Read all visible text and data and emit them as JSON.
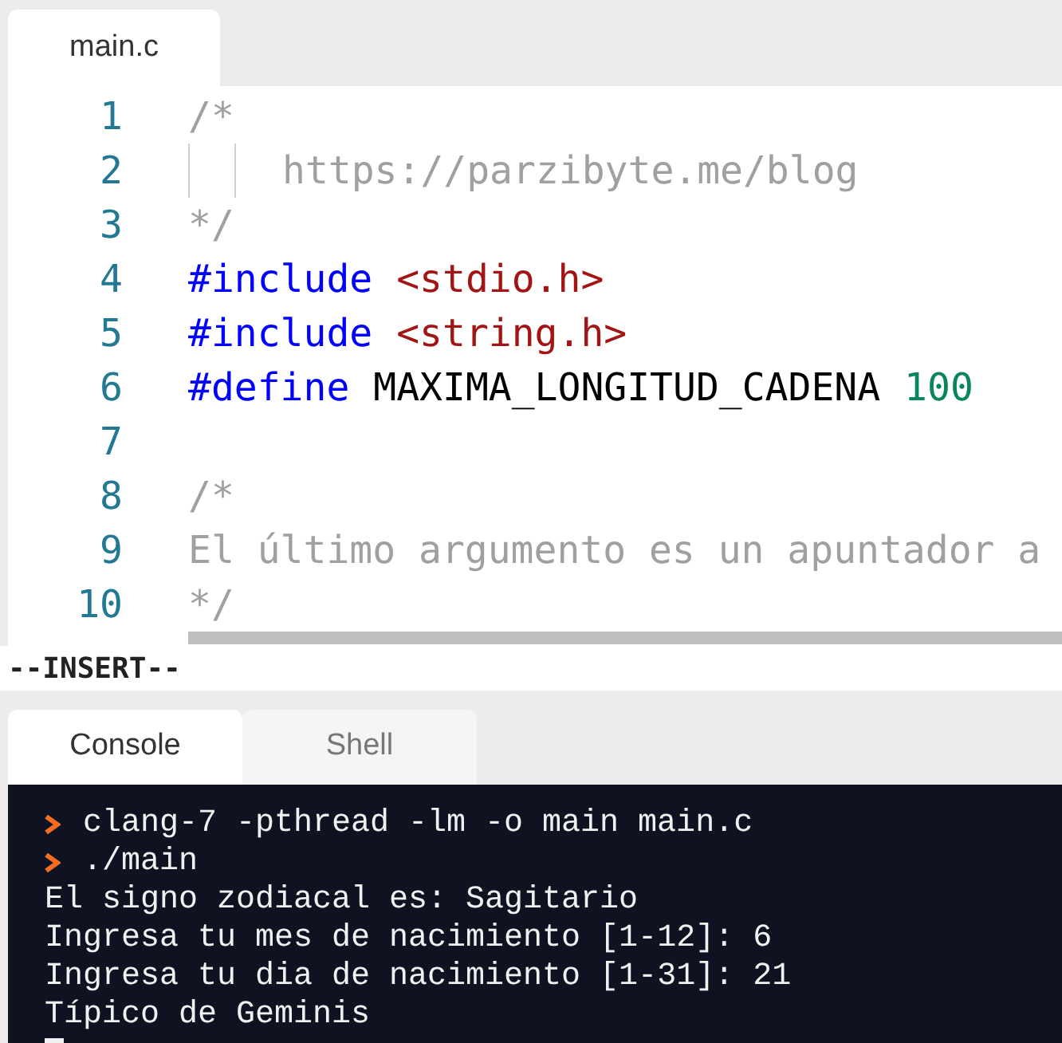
{
  "editor_tabs": [
    {
      "label": "main.c",
      "selected": true
    }
  ],
  "code_lines": [
    {
      "number": "1",
      "tokens": [
        {
          "kind": "comment",
          "text": "/*"
        }
      ]
    },
    {
      "number": "2",
      "guides": true,
      "tokens": [
        {
          "kind": "comment",
          "text": "https://parzibyte.me/blog"
        }
      ]
    },
    {
      "number": "3",
      "tokens": [
        {
          "kind": "comment",
          "text": "*/"
        }
      ]
    },
    {
      "number": "4",
      "tokens": [
        {
          "kind": "keyword",
          "text": "#include"
        },
        {
          "kind": "string",
          "text": "<stdio.h>"
        }
      ]
    },
    {
      "number": "5",
      "tokens": [
        {
          "kind": "keyword",
          "text": "#include"
        },
        {
          "kind": "string",
          "text": "<string.h>"
        }
      ]
    },
    {
      "number": "6",
      "tokens": [
        {
          "kind": "keyword",
          "text": "#define"
        },
        {
          "kind": "plain",
          "text": "MAXIMA_LONGITUD_CADENA"
        },
        {
          "kind": "number",
          "text": "100"
        }
      ]
    },
    {
      "number": "7"
    },
    {
      "number": "8",
      "tokens": [
        {
          "kind": "comment",
          "text": "/*"
        }
      ]
    },
    {
      "number": "9",
      "tokens": [
        {
          "kind": "comment",
          "text": "El último argumento es un apuntador a"
        }
      ]
    },
    {
      "number": "10",
      "tokens": [
        {
          "kind": "comment",
          "text": "*/"
        }
      ]
    }
  ],
  "mode_line": "--INSERT--",
  "console_tabs": [
    {
      "label": "Console",
      "selected": true
    },
    {
      "label": "Shell",
      "selected": false
    }
  ],
  "console_lines": [
    {
      "kind": "command",
      "text": "clang-7 -pthread -lm -o main main.c"
    },
    {
      "kind": "command",
      "text": "./main"
    },
    {
      "kind": "output",
      "text": "El signo zodiacal es: Sagitario"
    },
    {
      "kind": "output",
      "text": "Ingresa tu mes de nacimiento [1-12]: 6"
    },
    {
      "kind": "output",
      "text": "Ingresa tu dia de nacimiento [1-31]: 21"
    },
    {
      "kind": "output",
      "text": "Típico de Geminis"
    }
  ]
}
